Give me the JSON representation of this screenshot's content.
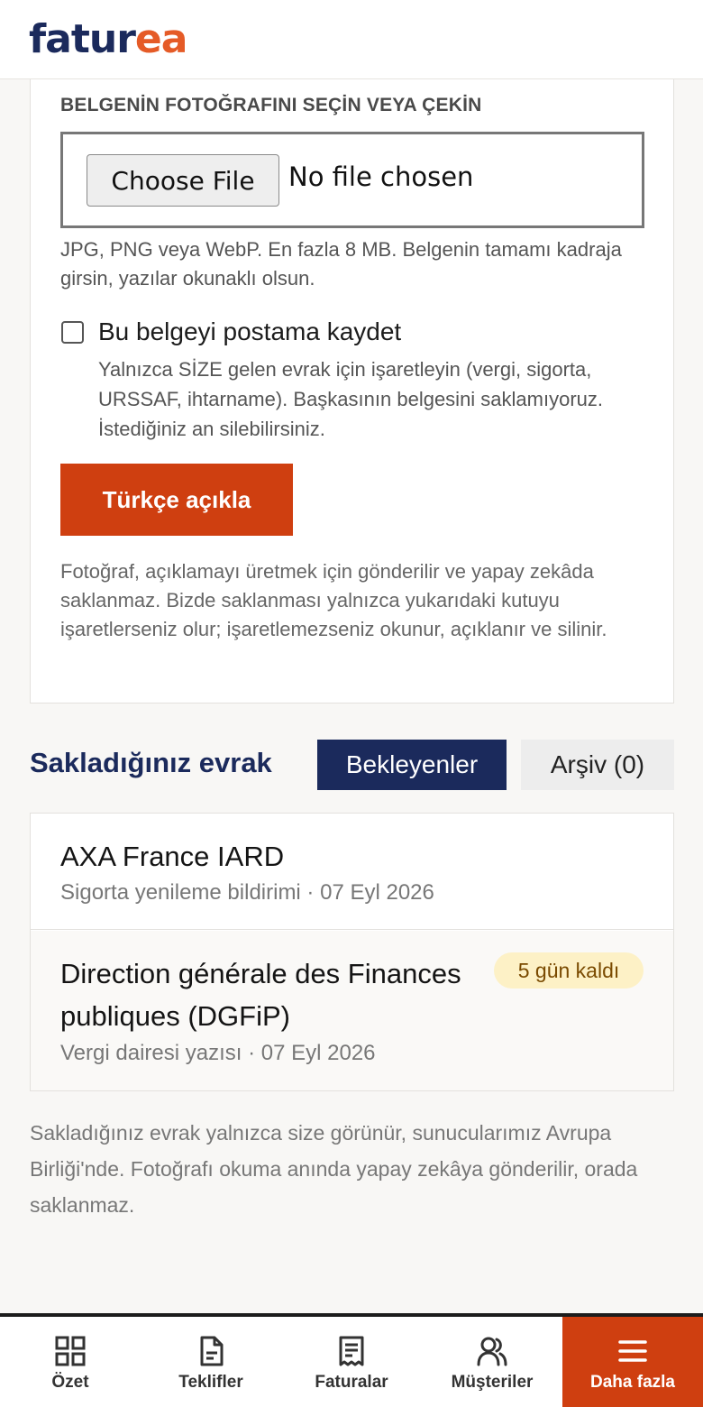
{
  "header": {
    "logo_part1": "fatur",
    "logo_part2": "ea"
  },
  "upload": {
    "heading": "BELGENİN FOTOĞRAFINI SEÇİN VEYA ÇEKİN",
    "file_button": "Choose File",
    "file_status": "No file chosen",
    "hint": "JPG, PNG veya WebP. En fazla 8 MB. Belgenin tamamı kadraja girsin, yazılar okunaklı olsun.",
    "checkbox_label": "Bu belgeyi postama kaydet",
    "checkbox_checked": false,
    "checkbox_help": "Yalnızca SİZE gelen evrak için işaretleyin (vergi, sigorta, URSSAF, ihtarname). Başkasının belgesini saklamıyoruz. İstediğiniz an silebilirsiniz.",
    "submit_label": "Türkçe açıkla",
    "privacy_note": "Fotoğraf, açıklamayı üretmek için gönderilir ve yapay zekâda saklanmaz. Bizde saklanması yalnızca yukarıdaki kutuyu işaretlerseniz olur; işaretlemezseniz okunur, açıklanır ve silinir."
  },
  "saved": {
    "title": "Sakladığınız evrak",
    "tabs": [
      {
        "label": "Bekleyenler",
        "active": true
      },
      {
        "label": "Arşiv (0)",
        "active": false
      }
    ],
    "items": [
      {
        "name": "AXA France IARD",
        "meta": "Sigorta yenileme bildirimi · 07 Eyl 2026",
        "badge": ""
      },
      {
        "name": "Direction générale des Finances publiques (DGFiP)",
        "meta": "Vergi dairesi yazısı · 07 Eyl 2026",
        "badge": "5 gün kaldı"
      }
    ],
    "footer_note": "Sakladığınız evrak yalnızca size görünür, sunucularımız Avrupa Birliği'nde. Fotoğrafı okuma anında yapay zekâya gönderilir, orada saklanmaz."
  },
  "nav": {
    "items": [
      {
        "label": "Özet",
        "icon": "grid-icon",
        "active": false
      },
      {
        "label": "Teklifler",
        "icon": "document-icon",
        "active": false
      },
      {
        "label": "Faturalar",
        "icon": "receipt-icon",
        "active": false
      },
      {
        "label": "Müşteriler",
        "icon": "users-icon",
        "active": false
      },
      {
        "label": "Daha fazla",
        "icon": "menu-icon",
        "active": true
      }
    ]
  },
  "colors": {
    "brand_navy": "#1b2a5c",
    "brand_orange": "#e55b27",
    "accent_button": "#cf3f10",
    "badge_bg": "#fdf1c6"
  }
}
